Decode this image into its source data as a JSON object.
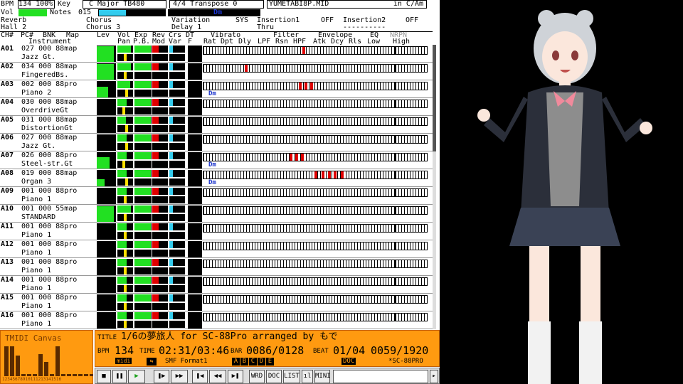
{
  "status": {
    "bpm_label": "BPM",
    "bpm": "134",
    "pct": "100%",
    "key_label": "Key",
    "key": "C Major",
    "tb_label": "TB",
    "tb": "480",
    "time_sig": "4/4",
    "transpose_label": "Transpose",
    "transpose": "0",
    "filename": "YUMETABI8P.MID",
    "in_label": "in C/Am"
  },
  "status2": {
    "vol_label": "Vol",
    "notes_label": "Notes",
    "notes": "015",
    "chord": "Dm"
  },
  "effects": {
    "reverb_label": "Reverb",
    "reverb": "Hall 2",
    "chorus_label": "Chorus",
    "chorus": "Chorus 3",
    "variation_label": "Variation",
    "variation": "Delay 1",
    "sys": "SYS",
    "insertion1_label": "Insertion1",
    "insertion1": "OFF",
    "insertion1_val": "Thru",
    "insertion2_label": "Insertion2",
    "insertion2": "OFF",
    "insertion2_val": "----------"
  },
  "headers": {
    "ch": "CH#",
    "pc": "PC#",
    "bnk": "BNK",
    "map": "Map",
    "instrument": "Instrument",
    "lev": "Lev",
    "vol": "Vol",
    "exp": "Exp",
    "rev": "Rev",
    "crs": "Crs",
    "dt": "DT",
    "pan": "Pan",
    "pb": "P.B.",
    "mod": "Mod",
    "var": "Var",
    "f": "F",
    "vibrato": "Vibrato",
    "rat": "Rat",
    "dpt": "Dpt",
    "dly": "Dly",
    "filter": "Filter",
    "lpf": "LPF",
    "rsn": "Rsn",
    "hpf": "HPF",
    "envelope": "Envelope",
    "atk": "Atk",
    "dcy": "Dcy",
    "rls": "Rls",
    "eq": "EQ",
    "low": "Low",
    "high": "High",
    "nrpn": "NRPN"
  },
  "channels": [
    {
      "ch": "A01",
      "pc": "027 000 88map",
      "name": "Jazz Gt.",
      "lev": 0.95,
      "vol": 0.85,
      "exp": 0.95,
      "pan": 0.5,
      "rev": 0.4,
      "notes": [
        0.52
      ],
      "chord": ""
    },
    {
      "ch": "A02",
      "pc": "034 000 88map",
      "name": "FingeredBs.",
      "lev": 0.95,
      "vol": 0.85,
      "exp": 0.95,
      "pan": 0.5,
      "rev": 0.4,
      "notes": [
        0.22
      ],
      "chord": ""
    },
    {
      "ch": "A03",
      "pc": "002 000 88pro",
      "name": "Piano 2",
      "lev": 0.65,
      "vol": 0.8,
      "exp": 0.95,
      "pan": 0.6,
      "rev": 0.4,
      "notes": [
        0.5,
        0.53,
        0.56
      ],
      "chord": "Dm"
    },
    {
      "ch": "A04",
      "pc": "030 000 88map",
      "name": "OverdriveGt",
      "lev": 0,
      "vol": 0.6,
      "exp": 0.95,
      "pan": 0.4,
      "rev": 0.4,
      "notes": [],
      "chord": ""
    },
    {
      "ch": "A05",
      "pc": "031 000 88map",
      "name": "DistortionGt",
      "lev": 0,
      "vol": 0.55,
      "exp": 0.95,
      "pan": 0.6,
      "rev": 0.4,
      "notes": [],
      "chord": ""
    },
    {
      "ch": "A06",
      "pc": "027 000 88map",
      "name": "Jazz Gt.",
      "lev": 0,
      "vol": 0.6,
      "exp": 0.95,
      "pan": 0.6,
      "rev": 0.4,
      "notes": [],
      "chord": ""
    },
    {
      "ch": "A07",
      "pc": "026 000 88pro",
      "name": "Steel-str.Gt",
      "lev": 0.7,
      "vol": 0.6,
      "exp": 0.95,
      "pan": 0.4,
      "rev": 0.4,
      "notes": [
        0.45,
        0.48,
        0.51
      ],
      "chord": "Dm"
    },
    {
      "ch": "A08",
      "pc": "019 000 88map",
      "name": "Organ 3",
      "lev": 0.45,
      "vol": 0.6,
      "exp": 0.95,
      "pan": 0.6,
      "rev": 0.4,
      "notes": [
        0.58,
        0.62,
        0.65,
        0.68,
        0.72
      ],
      "chord": "Dm"
    },
    {
      "ch": "A09",
      "pc": "001 000 88pro",
      "name": "Piano 1",
      "lev": 0,
      "vol": 0.6,
      "exp": 0.95,
      "pan": 0.5,
      "rev": 0.4,
      "notes": [],
      "chord": ""
    },
    {
      "ch": "A10",
      "pc": "001 000 55map",
      "name": "STANDARD",
      "lev": 0.95,
      "vol": 0.85,
      "exp": 0.95,
      "pan": 0.5,
      "rev": 0.4,
      "notes": [],
      "chord": ""
    },
    {
      "ch": "A11",
      "pc": "001 000 88pro",
      "name": "Piano 1",
      "lev": 0,
      "vol": 0.6,
      "exp": 0.95,
      "pan": 0.5,
      "rev": 0.4,
      "notes": [],
      "chord": ""
    },
    {
      "ch": "A12",
      "pc": "001 000 88pro",
      "name": "Piano 1",
      "lev": 0,
      "vol": 0.6,
      "exp": 0.95,
      "pan": 0.5,
      "rev": 0.4,
      "notes": [],
      "chord": ""
    },
    {
      "ch": "A13",
      "pc": "001 000 88pro",
      "name": "Piano 1",
      "lev": 0,
      "vol": 0.6,
      "exp": 0.95,
      "pan": 0.5,
      "rev": 0.4,
      "notes": [],
      "chord": ""
    },
    {
      "ch": "A14",
      "pc": "001 000 88pro",
      "name": "Piano 1",
      "lev": 0,
      "vol": 0.6,
      "exp": 0.95,
      "pan": 0.5,
      "rev": 0.4,
      "notes": [],
      "chord": ""
    },
    {
      "ch": "A15",
      "pc": "001 000 88pro",
      "name": "Piano 1",
      "lev": 0,
      "vol": 0.6,
      "exp": 0.95,
      "pan": 0.5,
      "rev": 0.4,
      "notes": [],
      "chord": ""
    },
    {
      "ch": "A16",
      "pc": "001 000 88pro",
      "name": "Piano 1",
      "lev": 0,
      "vol": 0.6,
      "exp": 0.95,
      "pan": 0.5,
      "rev": 0.4,
      "notes": [],
      "chord": ""
    }
  ],
  "logo": {
    "text": "TMIDI Canvas",
    "ticks": "12345678910111213141516"
  },
  "panel": {
    "title_label": "TITLE",
    "title": "1/6の夢旅人 for SC-88Pro arranged by もで",
    "bpm_label": "BPM",
    "bpm": "134",
    "time_label": "TIME",
    "time": "02:31/03:46",
    "bar_label": "BAR",
    "bar": "0086/0128",
    "beat_label": "BEAT",
    "beat": "01/04",
    "tick": "0059/1920",
    "midi": "midi",
    "format": "SMF Format1",
    "ports": [
      "A",
      "B",
      "C",
      "D",
      "E"
    ],
    "doc": "DOC",
    "device": "*SC-88PRO"
  },
  "controls": {
    "stop": "■",
    "pause": "❚❚",
    "play": "▶",
    "step": "❚▶",
    "ff": "▶▶",
    "prev": "❚◀",
    "rew": "◀◀",
    "next": "▶❚",
    "wrd": "WRD",
    "doc": "DOC",
    "list": "LIST",
    "mini": "MINI"
  },
  "colors": {
    "level": "#22e022",
    "note": "#e00000",
    "panel": "#ff9a10",
    "chord": "#1a33cc"
  }
}
